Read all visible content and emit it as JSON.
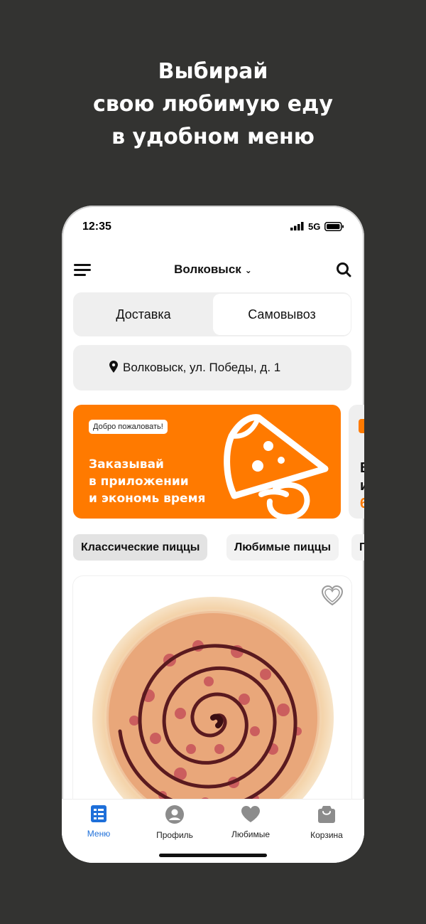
{
  "headline": {
    "line1": "Выбирай",
    "line2": "свою любимую еду",
    "line3": "в удобном меню"
  },
  "status_bar": {
    "time": "12:35",
    "network": "5G"
  },
  "header": {
    "city": "Волковыск",
    "menu_icon": "hamburger-icon",
    "search_icon": "search-icon"
  },
  "delivery_modes": {
    "delivery": "Доставка",
    "pickup": "Самовывоз",
    "selected": "Самовывоз"
  },
  "address": {
    "text": "Волковыск, ул. Победы, д. 1",
    "icon": "location-pin-icon"
  },
  "banner": {
    "badge": "Добро пожаловать!",
    "line1": "Заказывай",
    "line2": "в приложении",
    "line3": "и экономь время"
  },
  "banner_next": {
    "line1": "В",
    "line2": "и",
    "line3": "6"
  },
  "categories": [
    {
      "label": "Классические пиццы",
      "active": true
    },
    {
      "label": "Любимые пиццы",
      "active": false
    },
    {
      "label": "П",
      "active": false
    }
  ],
  "product": {
    "favorite_icon": "heart-outline-icon"
  },
  "tab_bar": {
    "items": [
      {
        "label": "Меню",
        "icon": "menu-list-icon",
        "active": true
      },
      {
        "label": "Профиль",
        "icon": "profile-icon",
        "active": false
      },
      {
        "label": "Любимые",
        "icon": "heart-icon",
        "active": false
      },
      {
        "label": "Корзина",
        "icon": "bag-icon",
        "active": false
      }
    ]
  },
  "colors": {
    "background": "#333331",
    "accent": "#ff7a00",
    "active_tab": "#1e6fd9"
  }
}
